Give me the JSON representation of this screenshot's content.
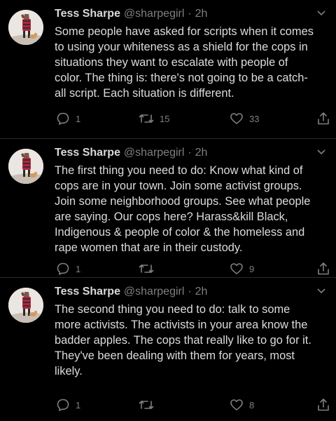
{
  "tweets": [
    {
      "name": "Tess Sharpe",
      "handle": "@sharpegirl",
      "dot": "·",
      "time": "2h",
      "text": "Some people have asked for scripts when it comes\nto using your whiteness as a shield for the cops in\nsituations they want to escalate with people of\ncolor. The thing is: there's not going to be a catch-\nall script. Each situation is different.",
      "replies": "1",
      "retweets": "15",
      "likes": "33"
    },
    {
      "name": "Tess Sharpe",
      "handle": "@sharpegirl",
      "dot": "·",
      "time": "2h",
      "text": "The first thing you need to do: Know what kind of\ncops are in your town. Join some activist groups.\nJoin some neighborhood groups. See what people\nare saying. Our cops here? Harass&kill Black,\nIndigenous & people of color & the homeless and\nrape women that are in their custody.",
      "replies": "1",
      "retweets": "",
      "likes": "9"
    },
    {
      "name": "Tess Sharpe",
      "handle": "@sharpegirl",
      "dot": "·",
      "time": "2h",
      "text": "The second thing you need to do: talk to some\nmore activists. The activists in your area know the\nbadder apples. The cops that really like to go for it.\nThey've been dealing with them for years, most\nlikely.",
      "replies": "1",
      "retweets": "",
      "likes": "8"
    }
  ],
  "icons": {
    "reply": "reply-icon",
    "retweet": "retweet-icon",
    "like": "heart-icon",
    "share": "share-icon",
    "menu": "chevron-down-icon",
    "avatar": "avatar"
  },
  "colors": {
    "background": "#000000",
    "text": "#d9d9d9",
    "muted": "#7f7f7f"
  }
}
